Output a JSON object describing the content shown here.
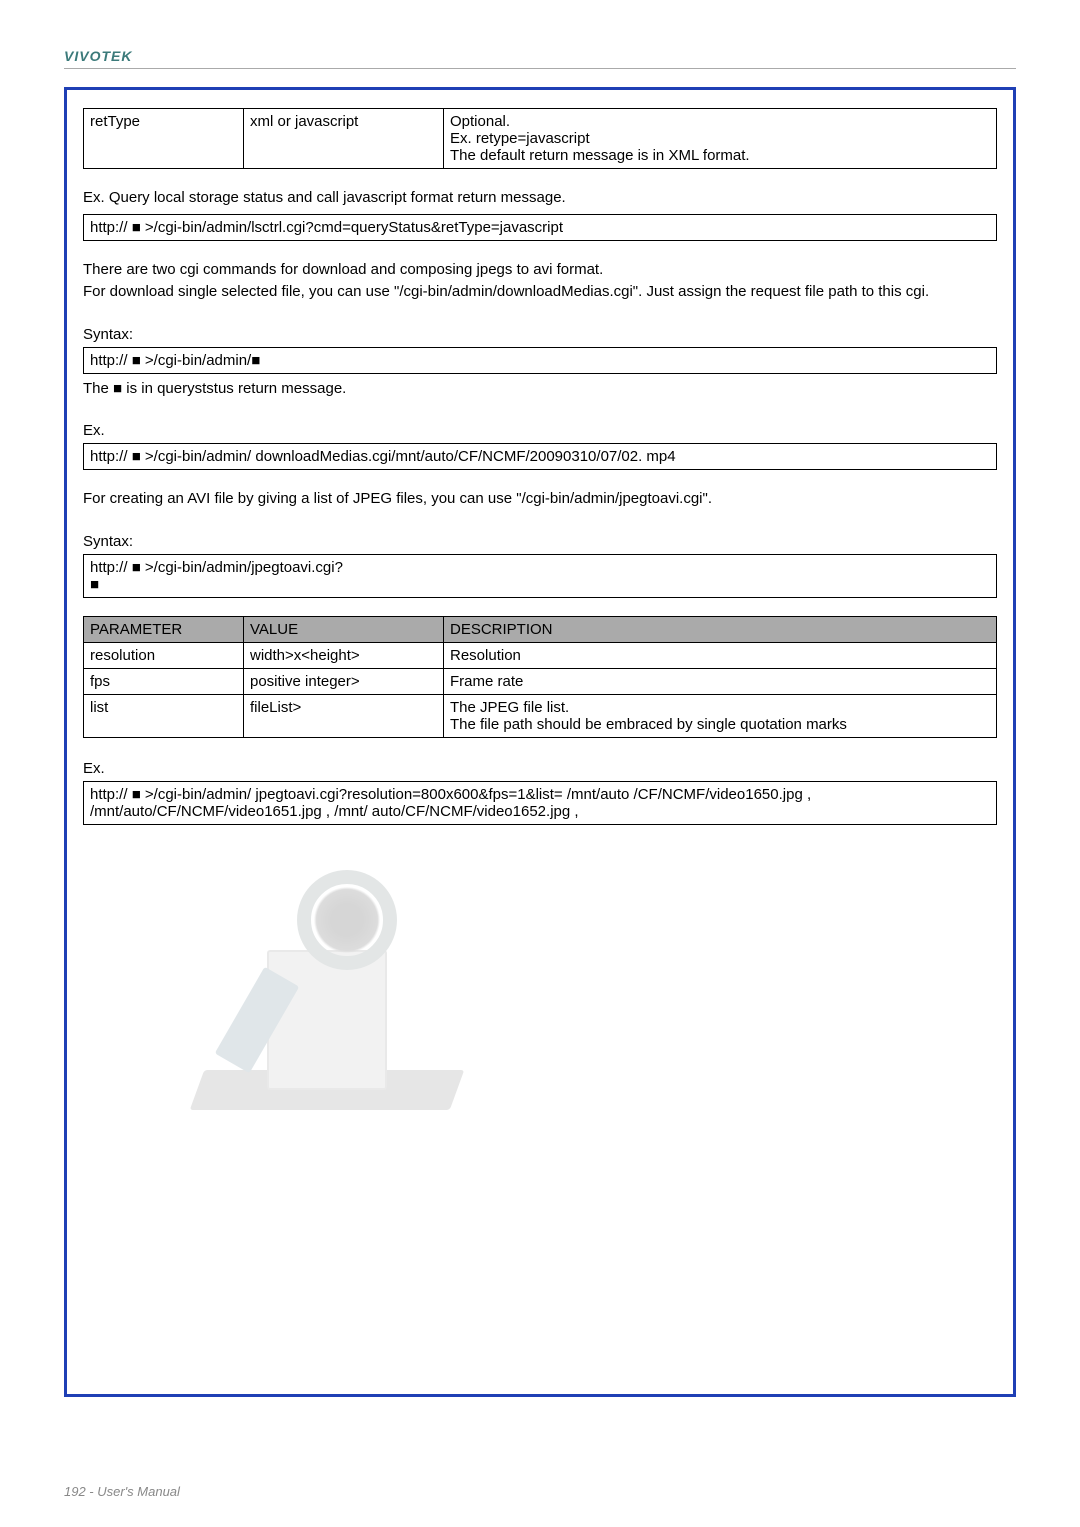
{
  "brand": "VIVOTEK",
  "t1": {
    "r1c1": "retType",
    "r1c2": "xml or javascript",
    "r1c3": "Optional.\nEx. retype=javascript\nThe default return message is in XML format."
  },
  "line_query": "Ex. Query local storage status and call javascript format return message.",
  "line_query2": "http:// ■ >/cgi-bin/admin/lsctrl.cgi?cmd=queryStatus&retType=javascript",
  "para1": "There are two cgi commands for download and composing jpegs to avi format.\nFor download single selected file, you can use \"/cgi-bin/admin/downloadMedias.cgi\". Just assign the request file path to this cgi.",
  "syntax": "Syntax:",
  "syntax1_box": "http:// ■ >/cgi-bin/admin/■",
  "syntax1_note": "The ■ is in queryststus return message.",
  "ex": "Ex.",
  "ex1_box": "http:// ■ >/cgi-bin/admin/ downloadMedias.cgi/mnt/auto/CF/NCMF/20090310/07/02. mp4",
  "para2": "For creating an AVI file by giving a list of JPEG files, you can use \"/cgi-bin/admin/jpegtoavi.cgi\".",
  "syntax2_box": "http:// ■ >/cgi-bin/admin/jpegtoavi.cgi?\n■",
  "t2": {
    "h1": "PARAMETER",
    "h2": "VALUE",
    "h3": "DESCRIPTION",
    "r1": {
      "c1": "resolution",
      "c2": "width>x<height>",
      "c3": "Resolution"
    },
    "r2": {
      "c1": "fps",
      "c2": "positive integer>",
      "c3": "Frame rate"
    },
    "r3": {
      "c1": "list",
      "c2": "fileList>",
      "c3": "The JPEG file list.\nThe file path should be embraced by single quotation marks"
    }
  },
  "ex2_box": "http:// ■ >/cgi-bin/admin/ jpegtoavi.cgi?resolution=800x600&fps=1&list= /mnt/auto /CF/NCMF/video1650.jpg , /mnt/auto/CF/NCMF/video1651.jpg , /mnt/ auto/CF/NCMF/video1652.jpg ,",
  "footer": "192 - User's Manual"
}
